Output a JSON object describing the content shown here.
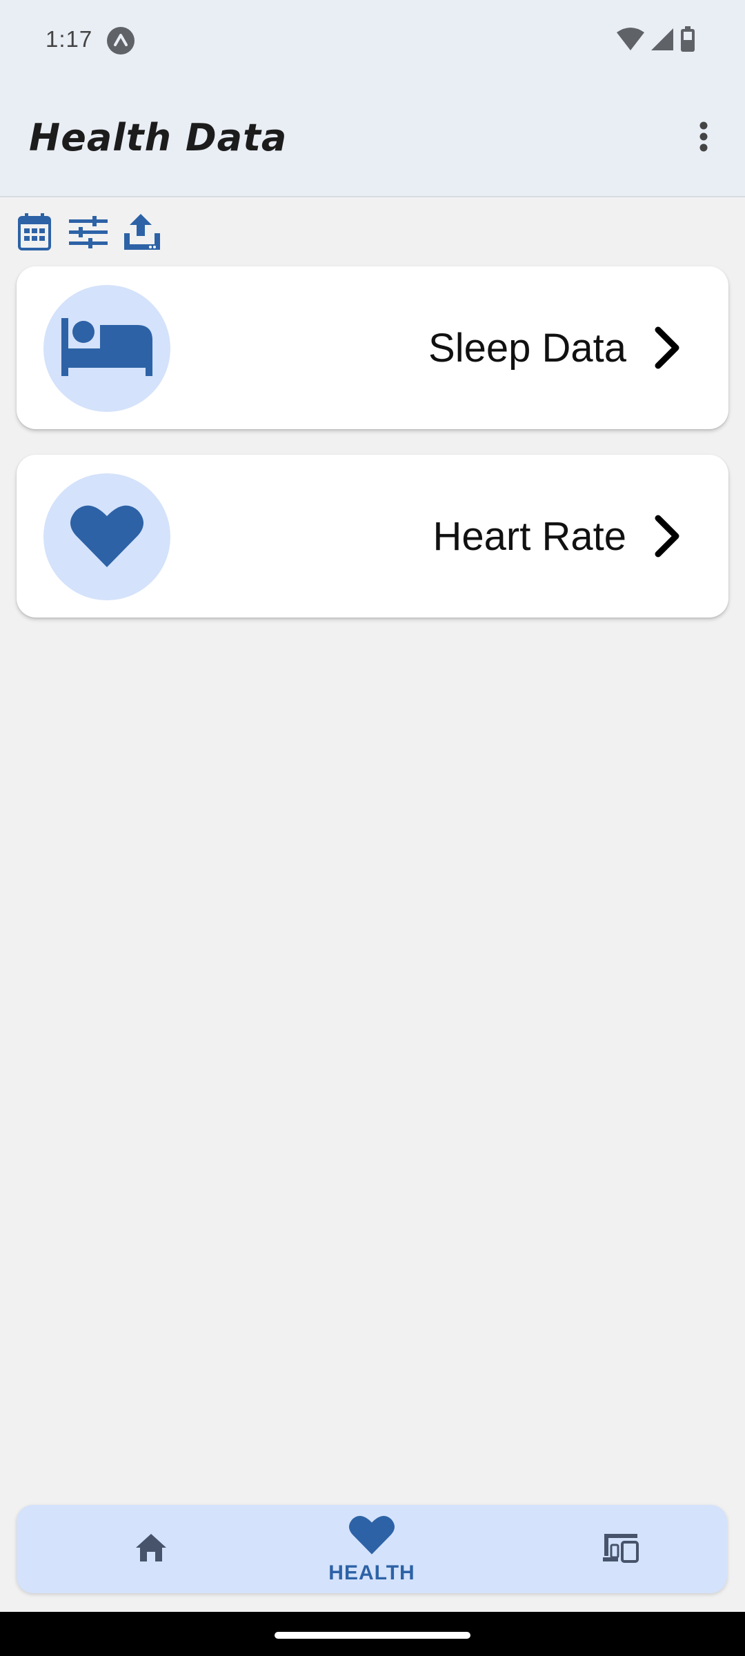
{
  "status_bar": {
    "time": "1:17",
    "icons": [
      "app-notification-icon",
      "wifi-icon",
      "cellular-signal-icon",
      "battery-icon"
    ]
  },
  "app_bar": {
    "title": "Health Data",
    "overflow_icon": "more-vert-icon"
  },
  "toolbar": {
    "icons": [
      "calendar-icon",
      "filter-sliders-icon",
      "upload-icon"
    ]
  },
  "cards": [
    {
      "label": "Sleep Data",
      "icon": "bed-icon"
    },
    {
      "label": "Heart Rate",
      "icon": "heart-icon"
    }
  ],
  "bottom_nav": {
    "items": [
      {
        "label": "",
        "icon": "home-icon",
        "selected": false
      },
      {
        "label": "HEALTH",
        "icon": "heart-icon",
        "selected": true
      },
      {
        "label": "",
        "icon": "devices-icon",
        "selected": false
      }
    ]
  },
  "colors": {
    "accent": "#2d62a6",
    "app_bar_bg": "#e9edf4",
    "icon_circle_bg": "#d4e2fb",
    "page_bg": "#f1f1f1"
  }
}
